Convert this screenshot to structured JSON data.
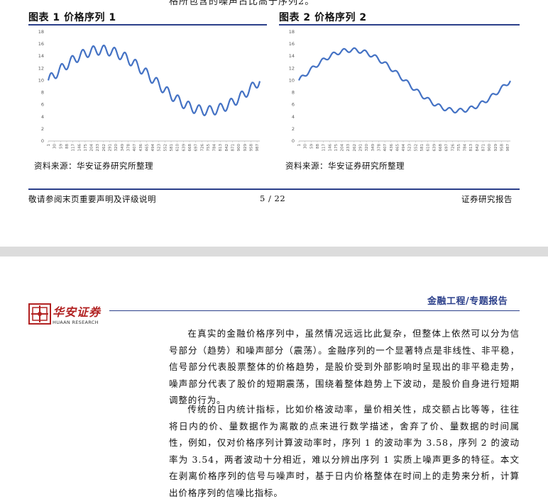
{
  "cut_line": "格所包含的噪声占比高于序列2。",
  "figure1": {
    "title": "图表 1 价格序列 1",
    "source": "资料来源：华安证券研究所整理"
  },
  "figure2": {
    "title": "图表 2 价格序列 2",
    "source": "资料来源：华安证券研究所整理"
  },
  "chart_data": [
    {
      "type": "line",
      "title": "",
      "ylim": [
        0,
        18
      ],
      "y_ticks": [
        "0",
        "2",
        "4",
        "6",
        "8",
        "10",
        "12",
        "14",
        "16",
        "18"
      ],
      "x_ticks": [
        "1",
        "30",
        "59",
        "88",
        "117",
        "146",
        "175",
        "204",
        "233",
        "262",
        "291",
        "320",
        "349",
        "378",
        "407",
        "436",
        "465",
        "494",
        "523",
        "552",
        "581",
        "610",
        "639",
        "668",
        "697",
        "726",
        "755",
        "784",
        "813",
        "842",
        "871",
        "900",
        "929",
        "958",
        "987"
      ],
      "xlim": [
        1,
        1000
      ],
      "grid": false,
      "legend": "none",
      "color": "#4472c4",
      "model": "10 + 5*sin(2*pi*(x-1)/1000) + 0.8*sin(2*pi*(x-1)/50)",
      "x": [
        1,
        25,
        50,
        75,
        100,
        125,
        150,
        175,
        200,
        225,
        250,
        275,
        300,
        325,
        350,
        375,
        400,
        425,
        450,
        475,
        500,
        525,
        550,
        575,
        600,
        625,
        650,
        675,
        700,
        725,
        750,
        775,
        800,
        825,
        850,
        875,
        900,
        925,
        950,
        975,
        1000
      ],
      "values": [
        10.0,
        10.8,
        11.5,
        13.1,
        12.9,
        13.4,
        14.6,
        14.6,
        14.4,
        15.0,
        15.0,
        14.4,
        14.6,
        14.6,
        13.4,
        12.9,
        13.1,
        11.5,
        10.8,
        10.0,
        9.2,
        8.5,
        6.9,
        7.1,
        6.6,
        5.4,
        5.4,
        5.6,
        5.0,
        5.0,
        5.6,
        5.4,
        5.4,
        6.6,
        7.1,
        6.9,
        8.5,
        9.2,
        10.0,
        10.8,
        10.0
      ]
    },
    {
      "type": "line",
      "title": "",
      "ylim": [
        0,
        18
      ],
      "y_ticks": [
        "0",
        "2",
        "4",
        "6",
        "8",
        "10",
        "12",
        "14",
        "16",
        "18"
      ],
      "x_ticks": [
        "1",
        "30",
        "59",
        "88",
        "117",
        "146",
        "175",
        "204",
        "233",
        "262",
        "291",
        "320",
        "349",
        "378",
        "407",
        "436",
        "465",
        "494",
        "523",
        "552",
        "581",
        "610",
        "639",
        "668",
        "697",
        "726",
        "755",
        "784",
        "813",
        "842",
        "871",
        "900",
        "929",
        "958",
        "987"
      ],
      "xlim": [
        1,
        1000
      ],
      "grid": false,
      "legend": "none",
      "color": "#4472c4",
      "model": "10 + 5*sin(2*pi*(x-1)/1000) + 0.35*sin(2*pi*(x-1)/50)",
      "x": [
        1,
        25,
        50,
        75,
        100,
        125,
        150,
        175,
        200,
        225,
        250,
        275,
        300,
        325,
        350,
        375,
        400,
        425,
        450,
        475,
        500,
        525,
        550,
        575,
        600,
        625,
        650,
        675,
        700,
        725,
        750,
        775,
        800,
        825,
        850,
        875,
        900,
        925,
        950,
        975,
        1000
      ],
      "values": [
        10.0,
        11.0,
        11.4,
        12.4,
        12.8,
        13.4,
        14.1,
        14.5,
        14.5,
        15.0,
        14.8,
        14.6,
        14.7,
        14.2,
        13.5,
        13.2,
        12.9,
        11.9,
        11.2,
        10.4,
        9.6,
        8.4,
        7.6,
        7.1,
        6.8,
        5.8,
        5.4,
        5.5,
        5.0,
        5.2,
        5.6,
        5.9,
        5.6,
        6.5,
        6.9,
        7.6,
        8.3,
        8.8,
        10.2,
        10.6,
        10.0
      ]
    }
  ],
  "footer": {
    "left": "敬请参阅末页重要声明及评级说明",
    "center": "5 / 22",
    "right": "证券研究报告"
  },
  "header": {
    "logo_text": "华安证券",
    "logo_sub": "HUAAN RESEARCH",
    "report_type": "金融工程/专题报告"
  },
  "body": {
    "paragraph1": "在真实的金融价格序列中，虽然情况远远比此复杂，但整体上依然可以分为信号部分（趋势）和噪声部分（震荡）。金融序列的一个显著特点是非线性、非平稳，信号部分代表股票整体的价格趋势，是股价受到外部影响时呈现出的非平稳走势，噪声部分代表了股价的短期震荡，围绕着整体趋势上下波动，是股价自身进行短期调整的行为。",
    "paragraph2": "传统的日内统计指标，比如价格波动率，量价相关性，成交额占比等等，往往将日内的价、量数据作为离散的点来进行数学描述，舍弃了价、量数据的时间属性，例如，仅对价格序列计算波动率时，序列 1 的波动率为 3.58，序列 2 的波动率为 3.54，两者波动十分相近，难以分辨出序列 1 实质上噪声更多的特征。本文在剥离价格序列的信号与噪声时，基于日内价格整体在时间上的走势来分析，计算出价格序列的信噪比指标。"
  },
  "colors": {
    "accent": "#2b3f8a",
    "line": "#4472c4",
    "logo": "#b22222"
  }
}
